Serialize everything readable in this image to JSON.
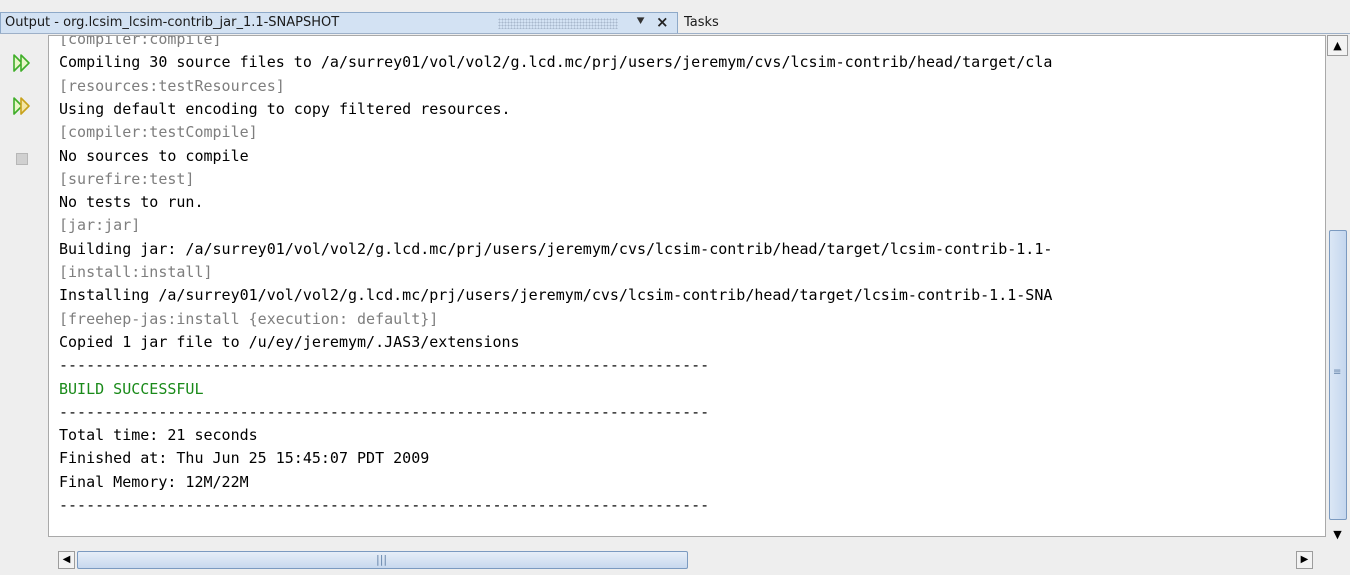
{
  "tabs": {
    "output_title": "Output - org.lcsim_lcsim-contrib_jar_1.1-SNAPSHOT",
    "tasks_title": "Tasks",
    "pin_glyph": "⯆",
    "close_glyph": "×"
  },
  "toolbar": {
    "rerun_icon": "rerun-icon",
    "rerun_with_options_icon": "rerun-with-options-icon",
    "stop_icon": "stop-icon",
    "accent": "#3fae29"
  },
  "output": {
    "lines": [
      {
        "text": "[compiler:compile]",
        "style": "gray"
      },
      {
        "text": "Compiling 30 source files to /a/surrey01/vol/vol2/g.lcd.mc/prj/users/jeremym/cvs/lcsim-contrib/head/target/cla",
        "style": "normal"
      },
      {
        "text": "[resources:testResources]",
        "style": "gray"
      },
      {
        "text": "Using default encoding to copy filtered resources.",
        "style": "normal"
      },
      {
        "text": "[compiler:testCompile]",
        "style": "gray"
      },
      {
        "text": "No sources to compile",
        "style": "normal"
      },
      {
        "text": "[surefire:test]",
        "style": "gray"
      },
      {
        "text": "No tests to run.",
        "style": "normal"
      },
      {
        "text": "[jar:jar]",
        "style": "gray"
      },
      {
        "text": "Building jar: /a/surrey01/vol/vol2/g.lcd.mc/prj/users/jeremym/cvs/lcsim-contrib/head/target/lcsim-contrib-1.1-",
        "style": "normal"
      },
      {
        "text": "[install:install]",
        "style": "gray"
      },
      {
        "text": "Installing /a/surrey01/vol/vol2/g.lcd.mc/prj/users/jeremym/cvs/lcsim-contrib/head/target/lcsim-contrib-1.1-SNA",
        "style": "normal"
      },
      {
        "text": "[freehep-jas:install {execution: default}]",
        "style": "gray"
      },
      {
        "text": "Copied 1 jar file to /u/ey/jeremym/.JAS3/extensions",
        "style": "normal"
      },
      {
        "text": "------------------------------------------------------------------------",
        "style": "normal"
      },
      {
        "text": "BUILD SUCCESSFUL",
        "style": "green"
      },
      {
        "text": "------------------------------------------------------------------------",
        "style": "normal"
      },
      {
        "text": "Total time: 21 seconds",
        "style": "normal"
      },
      {
        "text": "Finished at: Thu Jun 25 15:45:07 PDT 2009",
        "style": "normal"
      },
      {
        "text": "Final Memory: 12M/22M",
        "style": "normal"
      },
      {
        "text": "------------------------------------------------------------------------",
        "style": "normal"
      }
    ]
  },
  "scrollbars": {
    "vertical": {
      "up_glyph": "▲",
      "down_glyph": "▼",
      "grip_glyph": "≡"
    },
    "horizontal": {
      "left_glyph": "◀",
      "right_glyph": "▶",
      "grip_glyph": "|||"
    }
  }
}
